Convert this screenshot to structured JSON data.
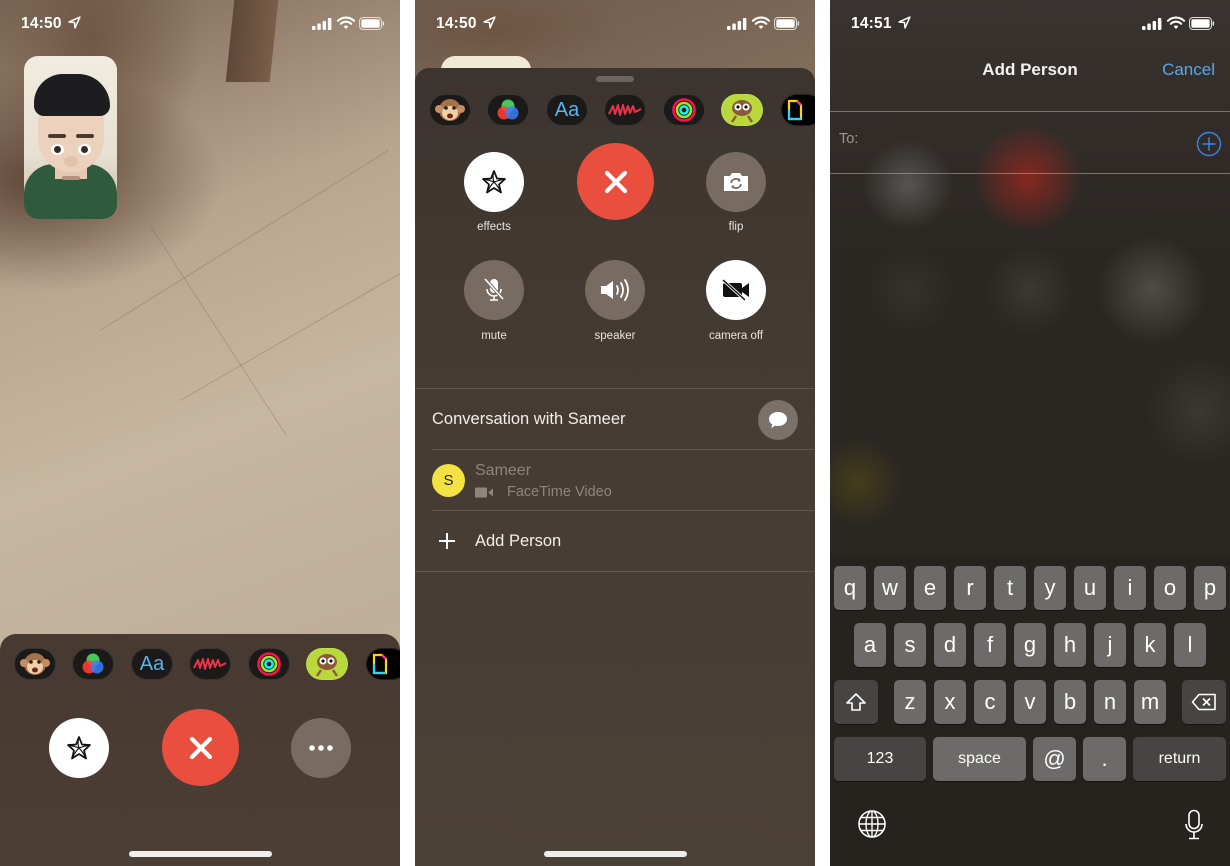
{
  "panels": [
    {
      "status": {
        "time": "14:50"
      },
      "call_controls": {
        "effects_icon": "effects-star-icon",
        "end_icon": "close-x-icon",
        "more_icon": "ellipsis-icon"
      }
    },
    {
      "status": {
        "time": "14:50"
      },
      "controls": [
        {
          "label": "effects",
          "icon": "effects-star-icon",
          "state": "on"
        },
        {
          "label": "",
          "icon": "close-x-icon",
          "state": "end-call"
        },
        {
          "label": "flip",
          "icon": "camera-flip-icon",
          "state": "off"
        },
        {
          "label": "mute",
          "icon": "mic-slash-icon",
          "state": "off"
        },
        {
          "label": "speaker",
          "icon": "speaker-wave-icon",
          "state": "off"
        },
        {
          "label": "camera off",
          "icon": "video-slash-icon",
          "state": "on"
        }
      ],
      "conversation": {
        "title": "Conversation with Sameer",
        "message_icon": "message-bubble-icon"
      },
      "participants": [
        {
          "initial": "S",
          "name": "Sameer",
          "status": "FaceTime Video",
          "avatar_color": "#f2e342"
        }
      ],
      "add_person_label": "Add Person"
    },
    {
      "status": {
        "time": "14:51"
      },
      "nav": {
        "title": "Add Person",
        "cancel_label": "Cancel"
      },
      "to_field": {
        "label": "To:",
        "value": "",
        "placeholder": ""
      },
      "keyboard": {
        "row1": [
          "q",
          "w",
          "e",
          "r",
          "t",
          "y",
          "u",
          "i",
          "o",
          "p"
        ],
        "row2": [
          "a",
          "s",
          "d",
          "f",
          "g",
          "h",
          "j",
          "k",
          "l"
        ],
        "row3": [
          "z",
          "x",
          "c",
          "v",
          "b",
          "n",
          "m"
        ],
        "numbers_label": "123",
        "space_label": "space",
        "at_label": "@",
        "dot_label": ".",
        "return_label": "return"
      }
    }
  ],
  "sticker_apps": [
    {
      "name": "animoji",
      "icon": "monkey-face-icon"
    },
    {
      "name": "filters",
      "icon": "color-circles-icon"
    },
    {
      "name": "text",
      "icon": "text-aa-icon",
      "text": "Aa"
    },
    {
      "name": "shapes",
      "icon": "scribble-icon"
    },
    {
      "name": "activity",
      "icon": "activity-rings-icon"
    },
    {
      "name": "monkey-stickers",
      "icon": "cartoon-monkey-icon"
    },
    {
      "name": "clips",
      "icon": "page-outline-icon"
    }
  ],
  "colors": {
    "end_call": "#e94e3e",
    "accent_blue": "#5aa8e8",
    "avatar_yellow": "#f2e342"
  }
}
